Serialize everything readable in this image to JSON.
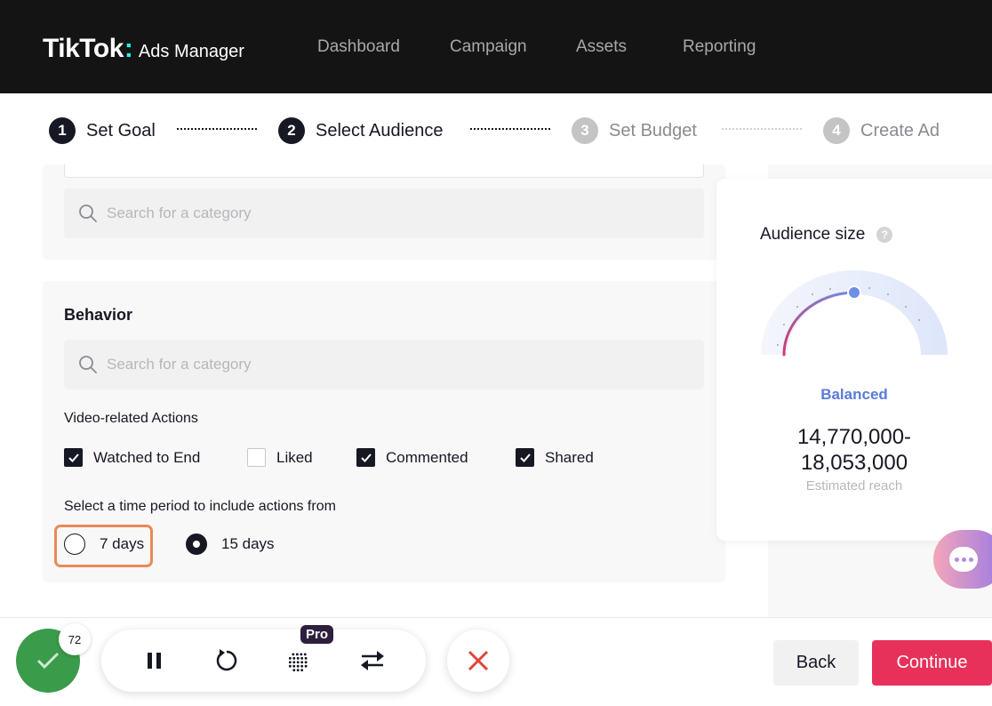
{
  "header": {
    "logo_text": "TikTok",
    "logo_colon": ":",
    "logo_sub": "Ads Manager",
    "nav": [
      "Dashboard",
      "Campaign",
      "Assets",
      "Reporting"
    ]
  },
  "stepper": {
    "steps": [
      {
        "num": "1",
        "label": "Set Goal",
        "state": "active"
      },
      {
        "num": "2",
        "label": "Select Audience",
        "state": "active"
      },
      {
        "num": "3",
        "label": "Set Budget",
        "state": "inactive"
      },
      {
        "num": "4",
        "label": "Create Ad",
        "state": "inactive"
      }
    ]
  },
  "interest": {
    "search_placeholder": "Search for a category"
  },
  "behavior": {
    "title": "Behavior",
    "search_placeholder": "Search for a category",
    "video_actions_label": "Video-related Actions",
    "checkboxes": [
      {
        "label": "Watched to End",
        "checked": true
      },
      {
        "label": "Liked",
        "checked": false
      },
      {
        "label": "Commented",
        "checked": true
      },
      {
        "label": "Shared",
        "checked": true
      }
    ],
    "time_period_label": "Select a time period to include actions from",
    "radios": [
      {
        "label": "7 days",
        "selected": false
      },
      {
        "label": "15 days",
        "selected": true
      }
    ]
  },
  "audience": {
    "title": "Audience size",
    "help_icon": "?",
    "level": 0.5,
    "status": "Balanced",
    "reach_line1": "14,770,000-",
    "reach_line2": "18,053,000",
    "reach_caption": "Estimated reach"
  },
  "toolbar": {
    "score": "72",
    "pro_label": "Pro"
  },
  "footer": {
    "back_label": "Back",
    "continue_label": "Continue"
  },
  "colors": {
    "accent": "#e8315a",
    "balanced": "#5a7bd8",
    "score_green": "#3a9b4a",
    "highlight": "#e98a55"
  }
}
